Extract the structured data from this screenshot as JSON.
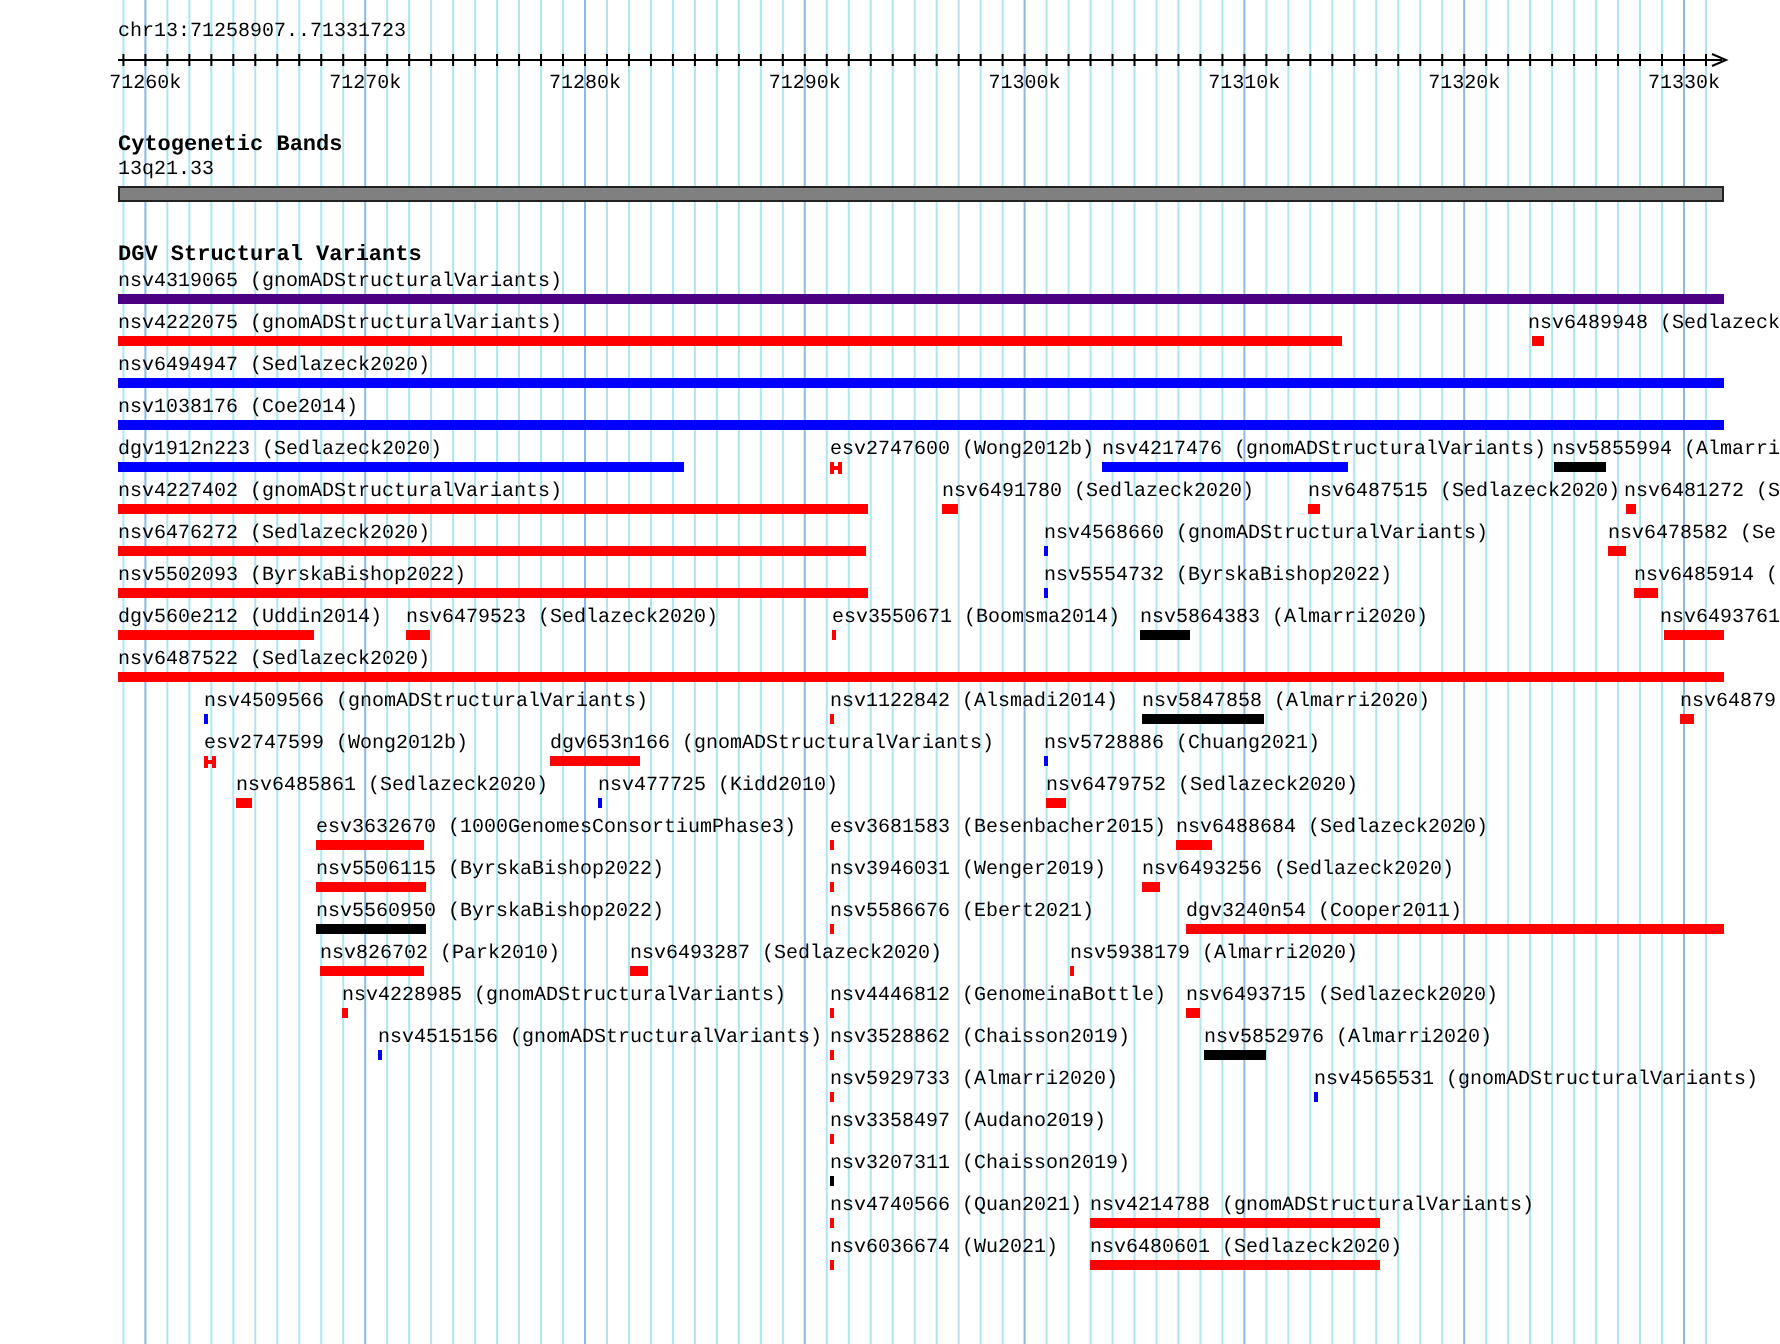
{
  "locus": "chr13:71258907..71331723",
  "ruler": {
    "ticks": [
      "71260k",
      "71270k",
      "71280k",
      "71290k",
      "71300k",
      "71310k",
      "71320k",
      "71330k"
    ]
  },
  "cytoband_track": {
    "title": "Cytogenetic Bands",
    "band": {
      "label": "13q21.33",
      "color": "#808080"
    }
  },
  "variant_track": {
    "title": "DGV Structural Variants",
    "rows": [
      {
        "features": [
          {
            "label": "nsv4319065 (gnomADStructuralVariants)",
            "color": "#4b0082",
            "kind": "bar"
          }
        ]
      },
      {
        "features": [
          {
            "label": "nsv4222075 (gnomADStructuralVariants)",
            "color": "#ff0000",
            "kind": "bar"
          },
          {
            "label": "nsv6489948 (Sedlazeck",
            "color": "#ff0000",
            "kind": "bar"
          }
        ]
      },
      {
        "features": [
          {
            "label": "nsv6494947 (Sedlazeck2020)",
            "color": "#0000ff",
            "kind": "bar"
          }
        ]
      },
      {
        "features": [
          {
            "label": "nsv1038176 (Coe2014)",
            "color": "#0000ff",
            "kind": "bar"
          }
        ]
      },
      {
        "features": [
          {
            "label": "dgv1912n223 (Sedlazeck2020)",
            "color": "#0000ff",
            "kind": "bar"
          },
          {
            "label": "esv2747600 (Wong2012b)",
            "color": "#ff0000",
            "kind": "paired"
          },
          {
            "label": "nsv4217476 (gnomADStructuralVariants)",
            "color": "#0000ff",
            "kind": "bar"
          },
          {
            "label": "nsv5855994 (Almarri",
            "color": "#000000",
            "kind": "bar"
          }
        ]
      },
      {
        "features": [
          {
            "label": "nsv4227402 (gnomADStructuralVariants)",
            "color": "#ff0000",
            "kind": "bar"
          },
          {
            "label": "nsv6491780 (Sedlazeck2020)",
            "color": "#ff0000",
            "kind": "bar"
          },
          {
            "label": "nsv6487515 (Sedlazeck2020)",
            "color": "#ff0000",
            "kind": "bar"
          },
          {
            "label": "nsv6481272 (S",
            "color": "#ff0000",
            "kind": "bar"
          }
        ]
      },
      {
        "features": [
          {
            "label": "nsv6476272 (Sedlazeck2020)",
            "color": "#ff0000",
            "kind": "bar"
          },
          {
            "label": "nsv4568660 (gnomADStructuralVariants)",
            "color": "#0000ff",
            "kind": "bar"
          },
          {
            "label": "nsv6478582 (Se",
            "color": "#ff0000",
            "kind": "bar"
          }
        ]
      },
      {
        "features": [
          {
            "label": "nsv5502093 (ByrskaBishop2022)",
            "color": "#ff0000",
            "kind": "bar"
          },
          {
            "label": "nsv5554732 (ByrskaBishop2022)",
            "color": "#0000ff",
            "kind": "bar"
          },
          {
            "label": "nsv6485914 (",
            "color": "#ff0000",
            "kind": "bar"
          }
        ]
      },
      {
        "features": [
          {
            "label": "dgv560e212 (Uddin2014)",
            "color": "#ff0000",
            "kind": "bar"
          },
          {
            "label": "nsv6479523 (Sedlazeck2020)",
            "color": "#ff0000",
            "kind": "bar"
          },
          {
            "label": "esv3550671 (Boomsma2014)",
            "color": "#ff0000",
            "kind": "bar"
          },
          {
            "label": "nsv5864383 (Almarri2020)",
            "color": "#000000",
            "kind": "bar"
          },
          {
            "label": "nsv6493761",
            "color": "#ff0000",
            "kind": "bar"
          }
        ]
      },
      {
        "features": [
          {
            "label": "nsv6487522 (Sedlazeck2020)",
            "color": "#ff0000",
            "kind": "bar"
          }
        ]
      },
      {
        "features": [
          {
            "label": "nsv4509566 (gnomADStructuralVariants)",
            "color": "#0000ff",
            "kind": "bar"
          },
          {
            "label": "nsv1122842 (Alsmadi2014)",
            "color": "#ff0000",
            "kind": "bar"
          },
          {
            "label": "nsv5847858 (Almarri2020)",
            "color": "#000000",
            "kind": "bar"
          },
          {
            "label": "nsv64879",
            "color": "#ff0000",
            "kind": "bar"
          }
        ]
      },
      {
        "features": [
          {
            "label": "esv2747599 (Wong2012b)",
            "color": "#ff0000",
            "kind": "paired"
          },
          {
            "label": "dgv653n166 (gnomADStructuralVariants)",
            "color": "#ff0000",
            "kind": "bar"
          },
          {
            "label": "nsv5728886 (Chuang2021)",
            "color": "#0000ff",
            "kind": "bar"
          }
        ]
      },
      {
        "features": [
          {
            "label": "nsv6485861 (Sedlazeck2020)",
            "color": "#ff0000",
            "kind": "bar"
          },
          {
            "label": "nsv477725 (Kidd2010)",
            "color": "#0000ff",
            "kind": "bar"
          },
          {
            "label": "nsv6479752 (Sedlazeck2020)",
            "color": "#ff0000",
            "kind": "bar"
          }
        ]
      },
      {
        "features": [
          {
            "label": "esv3632670 (1000GenomesConsortiumPhase3)",
            "color": "#ff0000",
            "kind": "bar"
          },
          {
            "label": "esv3681583 (Besenbacher2015)",
            "color": "#ff0000",
            "kind": "bar"
          },
          {
            "label": "nsv6488684 (Sedlazeck2020)",
            "color": "#ff0000",
            "kind": "bar"
          }
        ]
      },
      {
        "features": [
          {
            "label": "nsv5506115 (ByrskaBishop2022)",
            "color": "#ff0000",
            "kind": "bar"
          },
          {
            "label": "nsv3946031 (Wenger2019)",
            "color": "#ff0000",
            "kind": "bar"
          },
          {
            "label": "nsv6493256 (Sedlazeck2020)",
            "color": "#ff0000",
            "kind": "bar"
          }
        ]
      },
      {
        "features": [
          {
            "label": "nsv5560950 (ByrskaBishop2022)",
            "color": "#000000",
            "kind": "bar"
          },
          {
            "label": "nsv5586676 (Ebert2021)",
            "color": "#ff0000",
            "kind": "bar"
          },
          {
            "label": "dgv3240n54 (Cooper2011)",
            "color": "#ff0000",
            "kind": "bar"
          }
        ]
      },
      {
        "features": [
          {
            "label": "nsv826702 (Park2010)",
            "color": "#ff0000",
            "kind": "bar"
          },
          {
            "label": "nsv6493287 (Sedlazeck2020)",
            "color": "#ff0000",
            "kind": "bar"
          },
          {
            "label": "nsv5938179 (Almarri2020)",
            "color": "#ff0000",
            "kind": "bar"
          }
        ]
      },
      {
        "features": [
          {
            "label": "nsv4228985 (gnomADStructuralVariants)",
            "color": "#ff0000",
            "kind": "bar"
          },
          {
            "label": "nsv4446812 (GenomeinaBottle)",
            "color": "#ff0000",
            "kind": "bar"
          },
          {
            "label": "nsv6493715 (Sedlazeck2020)",
            "color": "#ff0000",
            "kind": "bar"
          }
        ]
      },
      {
        "features": [
          {
            "label": "nsv4515156 (gnomADStructuralVariants)",
            "color": "#0000ff",
            "kind": "bar"
          },
          {
            "label": "nsv3528862 (Chaisson2019)",
            "color": "#ff0000",
            "kind": "bar"
          },
          {
            "label": "nsv5852976 (Almarri2020)",
            "color": "#000000",
            "kind": "bar"
          }
        ]
      },
      {
        "features": [
          {
            "label": "nsv5929733 (Almarri2020)",
            "color": "#ff0000",
            "kind": "bar"
          },
          {
            "label": "nsv4565531 (gnomADStructuralVariants)",
            "color": "#0000ff",
            "kind": "bar"
          }
        ]
      },
      {
        "features": [
          {
            "label": "nsv3358497 (Audano2019)",
            "color": "#ff0000",
            "kind": "bar"
          }
        ]
      },
      {
        "features": [
          {
            "label": "nsv3207311 (Chaisson2019)",
            "color": "#000000",
            "kind": "bar"
          }
        ]
      },
      {
        "features": [
          {
            "label": "nsv4740566 (Quan2021)",
            "color": "#ff0000",
            "kind": "bar"
          },
          {
            "label": "nsv4214788 (gnomADStructuralVariants)",
            "color": "#ff0000",
            "kind": "bar"
          }
        ]
      },
      {
        "features": [
          {
            "label": "nsv6036674 (Wu2021)",
            "color": "#ff0000",
            "kind": "bar"
          },
          {
            "label": "nsv6480601 (Sedlazeck2020)",
            "color": "#ff0000",
            "kind": "bar"
          }
        ]
      }
    ]
  }
}
